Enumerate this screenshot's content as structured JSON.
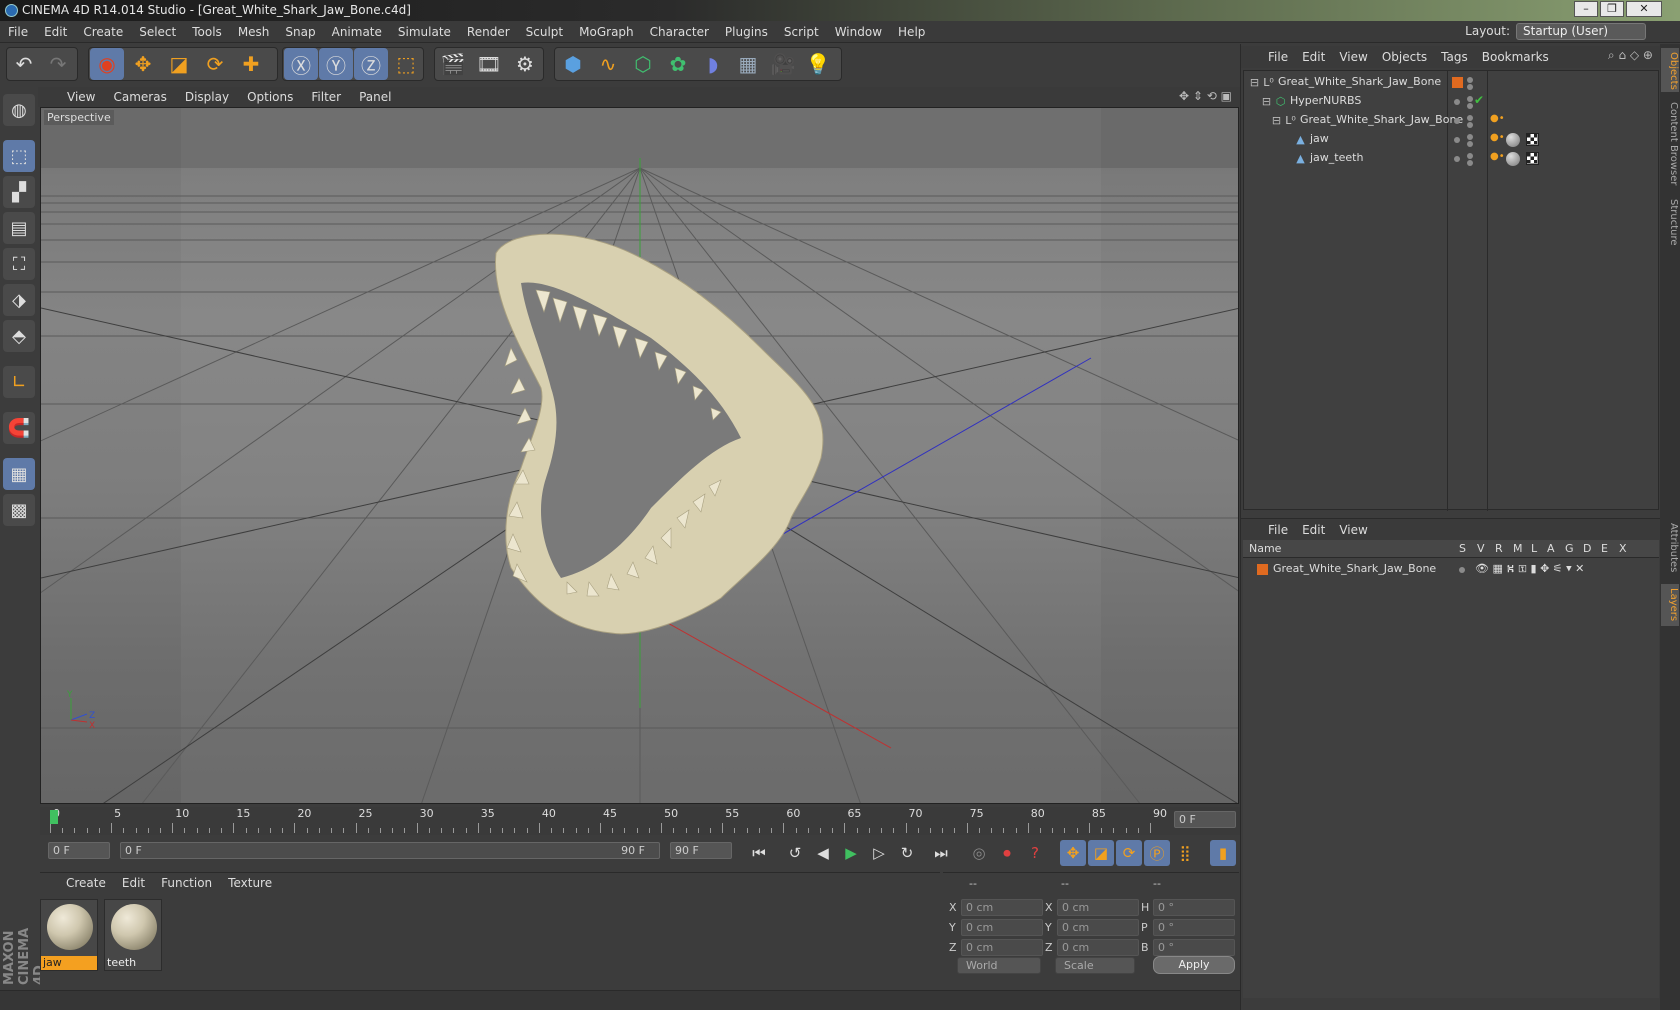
{
  "window": {
    "title": "CINEMA 4D R14.014 Studio - [Great_White_Shark_Jaw_Bone.c4d]"
  },
  "menubar": {
    "items": [
      "File",
      "Edit",
      "Create",
      "Select",
      "Tools",
      "Mesh",
      "Snap",
      "Animate",
      "Simulate",
      "Render",
      "Sculpt",
      "MoGraph",
      "Character",
      "Plugins",
      "Script",
      "Window",
      "Help"
    ],
    "layout_label": "Layout:",
    "layout_value": "Startup (User)"
  },
  "viewport": {
    "menu": [
      "View",
      "Cameras",
      "Display",
      "Options",
      "Filter",
      "Panel"
    ],
    "label": "Perspective"
  },
  "timeline": {
    "ticks": [
      "0",
      "5",
      "10",
      "15",
      "20",
      "25",
      "30",
      "35",
      "40",
      "45",
      "50",
      "55",
      "60",
      "65",
      "70",
      "75",
      "80",
      "85",
      "90"
    ],
    "current_frame": "0 F"
  },
  "transport": {
    "start": "0 F",
    "range_start": "0 F",
    "range_end": "90 F",
    "end": "90 F"
  },
  "materials": {
    "menu": [
      "Create",
      "Edit",
      "Function",
      "Texture"
    ],
    "items": [
      {
        "label": "jaw",
        "selected": true
      },
      {
        "label": "teeth",
        "selected": false
      }
    ]
  },
  "coordinates": {
    "headers": [
      "--",
      "--",
      "--"
    ],
    "rows": [
      {
        "a": "X",
        "av": "0 cm",
        "b": "X",
        "bv": "0 cm",
        "c": "H",
        "cv": "0 °"
      },
      {
        "a": "Y",
        "av": "0 cm",
        "b": "Y",
        "bv": "0 cm",
        "c": "P",
        "cv": "0 °"
      },
      {
        "a": "Z",
        "av": "0 cm",
        "b": "Z",
        "bv": "0 cm",
        "c": "B",
        "cv": "0 °"
      }
    ],
    "mode1": "World",
    "mode2": "Scale",
    "apply": "Apply"
  },
  "objects": {
    "menu": [
      "File",
      "Edit",
      "View",
      "Objects",
      "Tags",
      "Bookmarks"
    ],
    "tree": [
      {
        "name": "Great_White_Shark_Jaw_Bone",
        "indent": 0,
        "icon": "null-object-icon"
      },
      {
        "name": "HyperNURBS",
        "indent": 1,
        "icon": "hypernurbs-icon"
      },
      {
        "name": "Great_White_Shark_Jaw_Bone",
        "indent": 2,
        "icon": "null-object-icon"
      },
      {
        "name": "jaw",
        "indent": 3,
        "icon": "polygon-object-icon"
      },
      {
        "name": "jaw_teeth",
        "indent": 3,
        "icon": "polygon-object-icon"
      }
    ]
  },
  "layers": {
    "menu": [
      "File",
      "Edit",
      "View"
    ],
    "columns": [
      "Name",
      "S",
      "V",
      "R",
      "M",
      "L",
      "A",
      "G",
      "D",
      "E",
      "X"
    ],
    "rows": [
      {
        "name": "Great_White_Shark_Jaw_Bone",
        "color": "#e06a20"
      }
    ]
  },
  "sidetabs": [
    "Objects",
    "Content Browser",
    "Structure",
    "Attributes",
    "Layers"
  ],
  "colors": {
    "accent": "#5f7aa8",
    "selection": "#f4a020",
    "layer": "#e06a20"
  }
}
